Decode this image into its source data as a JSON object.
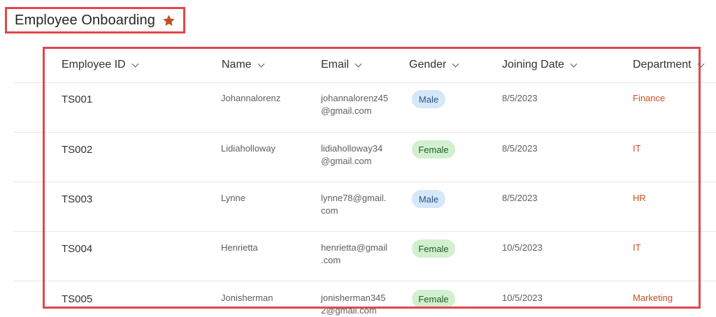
{
  "list": {
    "title": "Employee Onboarding",
    "favorite_icon": "star-icon",
    "accent_color": "#c2501c"
  },
  "columns": [
    {
      "label": "Employee ID"
    },
    {
      "label": "Name"
    },
    {
      "label": "Email"
    },
    {
      "label": "Gender"
    },
    {
      "label": "Joining Date"
    },
    {
      "label": "Department"
    }
  ],
  "rows": [
    {
      "id": "TS001",
      "name": "Johannalorenz",
      "email_l1": "johannalorenz45",
      "email_l2": "@gmail.com",
      "gender": "Male",
      "date": "8/5/2023",
      "dept": "Finance"
    },
    {
      "id": "TS002",
      "name": "Lidiaholloway",
      "email_l1": "lidiaholloway34",
      "email_l2": "@gmail.com",
      "gender": "Female",
      "date": "8/5/2023",
      "dept": "IT"
    },
    {
      "id": "TS003",
      "name": "Lynne",
      "email_l1": "lynne78@gmail.",
      "email_l2": "com",
      "gender": "Male",
      "date": "8/5/2023",
      "dept": "HR"
    },
    {
      "id": "TS004",
      "name": "Henrietta",
      "email_l1": "henrietta@gmail",
      "email_l2": ".com",
      "gender": "Female",
      "date": "10/5/2023",
      "dept": "IT"
    },
    {
      "id": "TS005",
      "name": "Jonisherman",
      "email_l1": "jonisherman345",
      "email_l2": "2@gmail.com",
      "gender": "Female",
      "date": "10/5/2023",
      "dept": "Marketing"
    }
  ],
  "colors": {
    "highlight_border": "#e0474c",
    "male_pill_bg": "#d6e7f7",
    "female_pill_bg": "#d2f0d0",
    "department_text": "#c8501e"
  }
}
